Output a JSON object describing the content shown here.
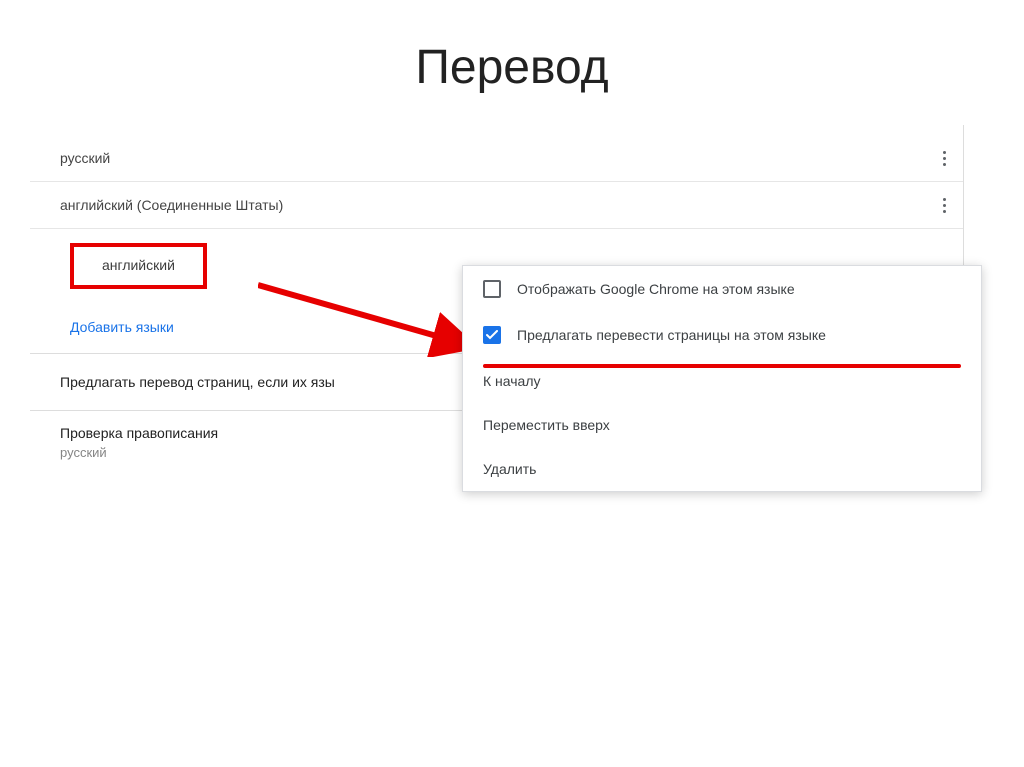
{
  "page": {
    "title": "Перевод"
  },
  "languages": {
    "items": [
      {
        "label": "русский"
      },
      {
        "label": "английский (Соединенные Штаты)"
      },
      {
        "label": "английский"
      }
    ],
    "add_link": "Добавить языки"
  },
  "offer_translate": "Предлагать перевод страниц, если их язы",
  "spellcheck": {
    "title": "Проверка правописания",
    "lang": "русский"
  },
  "popup": {
    "display_in_chrome": "Отображать Google Chrome на этом языке",
    "offer_translate": "Предлагать перевести страницы на этом языке",
    "move_top": "К началу",
    "move_up": "Переместить вверх",
    "remove": "Удалить"
  }
}
